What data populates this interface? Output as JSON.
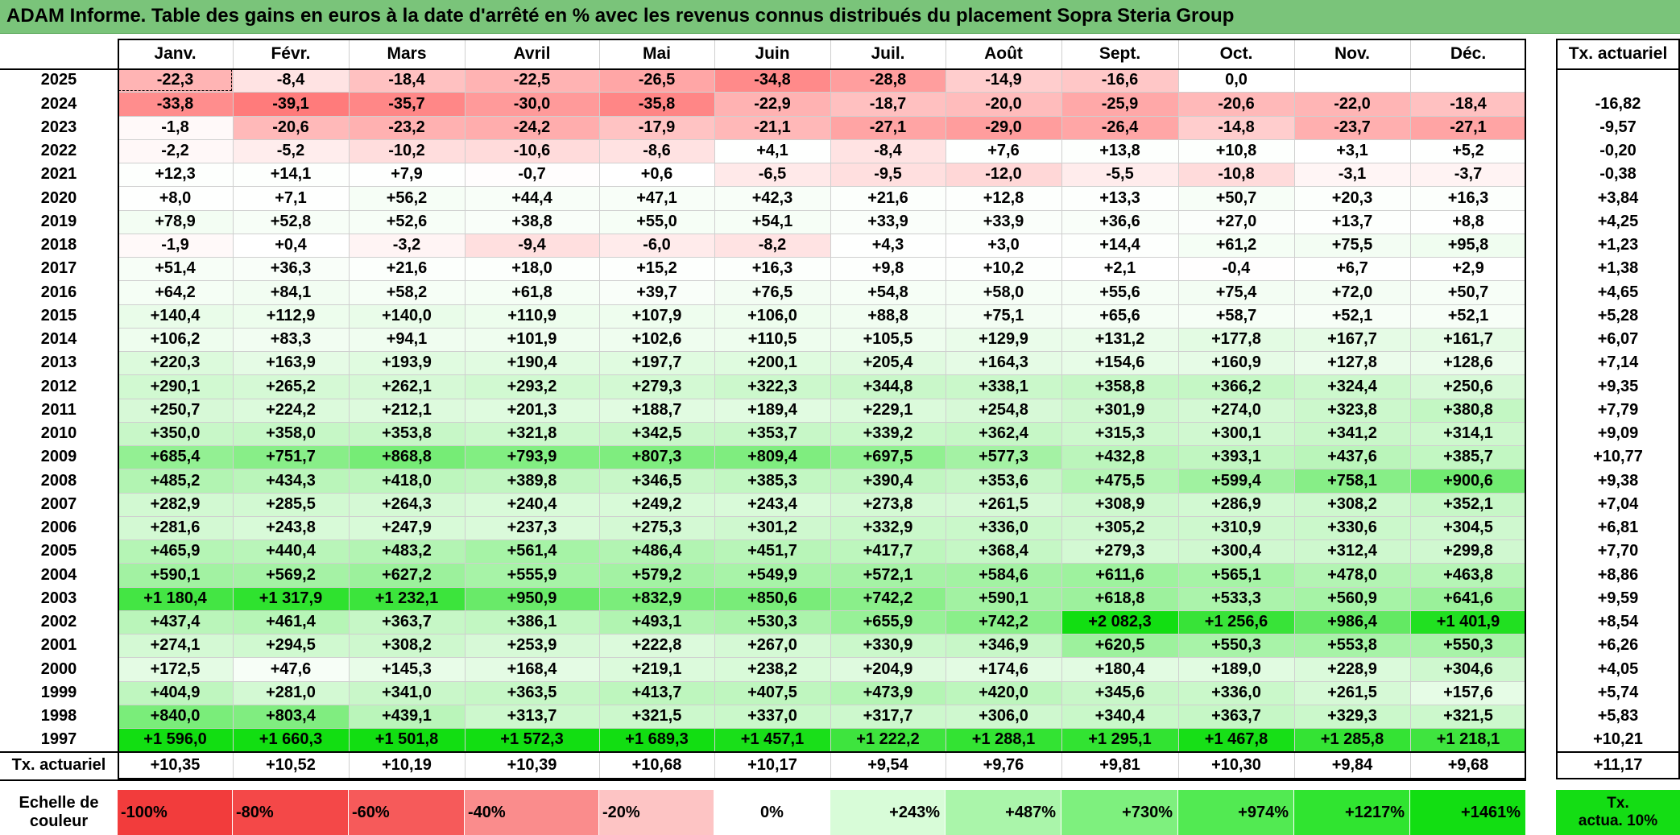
{
  "title": "ADAM Informe. Table des gains en euros à la date d'arrêté en % avec les revenus connus distribués du placement Sopra Steria Group",
  "months": [
    "Janv.",
    "Févr.",
    "Mars",
    "Avril",
    "Mai",
    "Juin",
    "Juil.",
    "Août",
    "Sept.",
    "Oct.",
    "Nov.",
    "Déc."
  ],
  "tx_header": "Tx. actuariel",
  "rows": [
    {
      "year": "2025",
      "values": [
        "-22,3",
        "-8,4",
        "-18,4",
        "-22,5",
        "-26,5",
        "-34,8",
        "-28,8",
        "-14,9",
        "-16,6",
        "0,0",
        "",
        ""
      ],
      "tx": ""
    },
    {
      "year": "2024",
      "values": [
        "-33,8",
        "-39,1",
        "-35,7",
        "-30,0",
        "-35,8",
        "-22,9",
        "-18,7",
        "-20,0",
        "-25,9",
        "-20,6",
        "-22,0",
        "-18,4"
      ],
      "tx": "-16,82"
    },
    {
      "year": "2023",
      "values": [
        "-1,8",
        "-20,6",
        "-23,2",
        "-24,2",
        "-17,9",
        "-21,1",
        "-27,1",
        "-29,0",
        "-26,4",
        "-14,8",
        "-23,7",
        "-27,1"
      ],
      "tx": "-9,57"
    },
    {
      "year": "2022",
      "values": [
        "-2,2",
        "-5,2",
        "-10,2",
        "-10,6",
        "-8,6",
        "+4,1",
        "-8,4",
        "+7,6",
        "+13,8",
        "+10,8",
        "+3,1",
        "+5,2"
      ],
      "tx": "-0,20"
    },
    {
      "year": "2021",
      "values": [
        "+12,3",
        "+14,1",
        "+7,9",
        "-0,7",
        "+0,6",
        "-6,5",
        "-9,5",
        "-12,0",
        "-5,5",
        "-10,8",
        "-3,1",
        "-3,7"
      ],
      "tx": "-0,38"
    },
    {
      "year": "2020",
      "values": [
        "+8,0",
        "+7,1",
        "+56,2",
        "+44,4",
        "+47,1",
        "+42,3",
        "+21,6",
        "+12,8",
        "+13,3",
        "+50,7",
        "+20,3",
        "+16,3"
      ],
      "tx": "+3,84"
    },
    {
      "year": "2019",
      "values": [
        "+78,9",
        "+52,8",
        "+52,6",
        "+38,8",
        "+55,0",
        "+54,1",
        "+33,9",
        "+33,9",
        "+36,6",
        "+27,0",
        "+13,7",
        "+8,8"
      ],
      "tx": "+4,25"
    },
    {
      "year": "2018",
      "values": [
        "-1,9",
        "+0,4",
        "-3,2",
        "-9,4",
        "-6,0",
        "-8,2",
        "+4,3",
        "+3,0",
        "+14,4",
        "+61,2",
        "+75,5",
        "+95,8"
      ],
      "tx": "+1,23"
    },
    {
      "year": "2017",
      "values": [
        "+51,4",
        "+36,3",
        "+21,6",
        "+18,0",
        "+15,2",
        "+16,3",
        "+9,8",
        "+10,2",
        "+2,1",
        "-0,4",
        "+6,7",
        "+2,9"
      ],
      "tx": "+1,38"
    },
    {
      "year": "2016",
      "values": [
        "+64,2",
        "+84,1",
        "+58,2",
        "+61,8",
        "+39,7",
        "+76,5",
        "+54,8",
        "+58,0",
        "+55,6",
        "+75,4",
        "+72,0",
        "+50,7"
      ],
      "tx": "+4,65"
    },
    {
      "year": "2015",
      "values": [
        "+140,4",
        "+112,9",
        "+140,0",
        "+110,9",
        "+107,9",
        "+106,0",
        "+88,8",
        "+75,1",
        "+65,6",
        "+58,7",
        "+52,1",
        "+52,1"
      ],
      "tx": "+5,28"
    },
    {
      "year": "2014",
      "values": [
        "+106,2",
        "+83,3",
        "+94,1",
        "+101,9",
        "+102,6",
        "+110,5",
        "+105,5",
        "+129,9",
        "+131,2",
        "+177,8",
        "+167,7",
        "+161,7"
      ],
      "tx": "+6,07"
    },
    {
      "year": "2013",
      "values": [
        "+220,3",
        "+163,9",
        "+193,9",
        "+190,4",
        "+197,7",
        "+200,1",
        "+205,4",
        "+164,3",
        "+154,6",
        "+160,9",
        "+127,8",
        "+128,6"
      ],
      "tx": "+7,14"
    },
    {
      "year": "2012",
      "values": [
        "+290,1",
        "+265,2",
        "+262,1",
        "+293,2",
        "+279,3",
        "+322,3",
        "+344,8",
        "+338,1",
        "+358,8",
        "+366,2",
        "+324,4",
        "+250,6"
      ],
      "tx": "+9,35"
    },
    {
      "year": "2011",
      "values": [
        "+250,7",
        "+224,2",
        "+212,1",
        "+201,3",
        "+188,7",
        "+189,4",
        "+229,1",
        "+254,8",
        "+301,9",
        "+274,0",
        "+323,8",
        "+380,8"
      ],
      "tx": "+7,79"
    },
    {
      "year": "2010",
      "values": [
        "+350,0",
        "+358,0",
        "+353,8",
        "+321,8",
        "+342,5",
        "+353,7",
        "+339,2",
        "+362,4",
        "+315,3",
        "+300,1",
        "+341,2",
        "+314,1"
      ],
      "tx": "+9,09"
    },
    {
      "year": "2009",
      "values": [
        "+685,4",
        "+751,7",
        "+868,8",
        "+793,9",
        "+807,3",
        "+809,4",
        "+697,5",
        "+577,3",
        "+432,8",
        "+393,1",
        "+437,6",
        "+385,7"
      ],
      "tx": "+10,77"
    },
    {
      "year": "2008",
      "values": [
        "+485,2",
        "+434,3",
        "+418,0",
        "+389,8",
        "+346,5",
        "+385,3",
        "+390,4",
        "+353,6",
        "+475,5",
        "+599,4",
        "+758,1",
        "+900,6"
      ],
      "tx": "+9,38"
    },
    {
      "year": "2007",
      "values": [
        "+282,9",
        "+285,5",
        "+264,3",
        "+240,4",
        "+249,2",
        "+243,4",
        "+273,8",
        "+261,5",
        "+308,9",
        "+286,9",
        "+308,2",
        "+352,1"
      ],
      "tx": "+7,04"
    },
    {
      "year": "2006",
      "values": [
        "+281,6",
        "+243,8",
        "+247,9",
        "+237,3",
        "+275,3",
        "+301,2",
        "+332,9",
        "+336,0",
        "+305,2",
        "+310,9",
        "+330,6",
        "+304,5"
      ],
      "tx": "+6,81"
    },
    {
      "year": "2005",
      "values": [
        "+465,9",
        "+440,4",
        "+483,2",
        "+561,4",
        "+486,4",
        "+451,7",
        "+417,7",
        "+368,4",
        "+279,3",
        "+300,4",
        "+312,4",
        "+299,8"
      ],
      "tx": "+7,70"
    },
    {
      "year": "2004",
      "values": [
        "+590,1",
        "+569,2",
        "+627,2",
        "+555,9",
        "+579,2",
        "+549,9",
        "+572,1",
        "+584,6",
        "+611,6",
        "+565,1",
        "+478,0",
        "+463,8"
      ],
      "tx": "+8,86"
    },
    {
      "year": "2003",
      "values": [
        "+1 180,4",
        "+1 317,9",
        "+1 232,1",
        "+950,9",
        "+832,9",
        "+850,6",
        "+742,2",
        "+590,1",
        "+618,8",
        "+533,3",
        "+560,9",
        "+641,6"
      ],
      "tx": "+9,59"
    },
    {
      "year": "2002",
      "values": [
        "+437,4",
        "+461,4",
        "+363,7",
        "+386,1",
        "+493,1",
        "+530,3",
        "+655,9",
        "+742,2",
        "+2 082,3",
        "+1 256,6",
        "+986,4",
        "+1 401,9"
      ],
      "tx": "+8,54"
    },
    {
      "year": "2001",
      "values": [
        "+274,1",
        "+294,5",
        "+308,2",
        "+253,9",
        "+222,8",
        "+267,0",
        "+330,9",
        "+346,9",
        "+620,5",
        "+550,3",
        "+553,8",
        "+550,3"
      ],
      "tx": "+6,26"
    },
    {
      "year": "2000",
      "values": [
        "+172,5",
        "+47,6",
        "+145,3",
        "+168,4",
        "+219,1",
        "+238,2",
        "+204,9",
        "+174,6",
        "+180,4",
        "+189,0",
        "+228,9",
        "+304,6"
      ],
      "tx": "+4,05"
    },
    {
      "year": "1999",
      "values": [
        "+404,9",
        "+281,0",
        "+341,0",
        "+363,5",
        "+413,7",
        "+407,5",
        "+473,9",
        "+420,0",
        "+345,6",
        "+336,0",
        "+261,5",
        "+157,6"
      ],
      "tx": "+5,74"
    },
    {
      "year": "1998",
      "values": [
        "+840,0",
        "+803,4",
        "+439,1",
        "+313,7",
        "+321,5",
        "+337,0",
        "+317,7",
        "+306,0",
        "+340,4",
        "+363,7",
        "+329,3",
        "+321,5"
      ],
      "tx": "+5,83"
    },
    {
      "year": "1997",
      "values": [
        "+1 596,0",
        "+1 660,3",
        "+1 501,8",
        "+1 572,3",
        "+1 689,3",
        "+1 457,1",
        "+1 222,2",
        "+1 288,1",
        "+1 295,1",
        "+1 467,8",
        "+1 285,8",
        "+1 218,1"
      ],
      "tx": "+10,21"
    }
  ],
  "footer": {
    "label": "Tx. actuariel",
    "values": [
      "+10,35",
      "+10,52",
      "+10,19",
      "+10,39",
      "+10,68",
      "+10,17",
      "+9,54",
      "+9,76",
      "+9,81",
      "+10,30",
      "+9,84",
      "+9,68"
    ],
    "total": "+11,17"
  },
  "scale": {
    "label_line1": "Echelle de",
    "label_line2": "couleur",
    "items": [
      {
        "text": "-100%",
        "color": "#f23c3c",
        "align": "left"
      },
      {
        "text": "-80%",
        "color": "#f44848",
        "align": "left"
      },
      {
        "text": "-60%",
        "color": "#f65a5a",
        "align": "left"
      },
      {
        "text": "-40%",
        "color": "#fa8c8c",
        "align": "left"
      },
      {
        "text": "-20%",
        "color": "#fdc4c4",
        "align": "left"
      },
      {
        "text": "0%",
        "color": "#ffffff",
        "align": "center"
      },
      {
        "text": "+243%",
        "color": "#d8fcd8",
        "align": "right"
      },
      {
        "text": "+487%",
        "color": "#aaf5aa",
        "align": "right"
      },
      {
        "text": "+730%",
        "color": "#7ef07e",
        "align": "right"
      },
      {
        "text": "+974%",
        "color": "#52ea52",
        "align": "right"
      },
      {
        "text": "+1217%",
        "color": "#30e430",
        "align": "right"
      },
      {
        "text": "+1461%",
        "color": "#12de12",
        "align": "right"
      }
    ],
    "legend_line1": "Tx.",
    "legend_line2": "actua. 10%",
    "legend_color": "#14dd14"
  },
  "colors": {
    "title_bg": "#7ac47a",
    "negative_full": "#f23c3c",
    "positive_full": "#12de12"
  }
}
